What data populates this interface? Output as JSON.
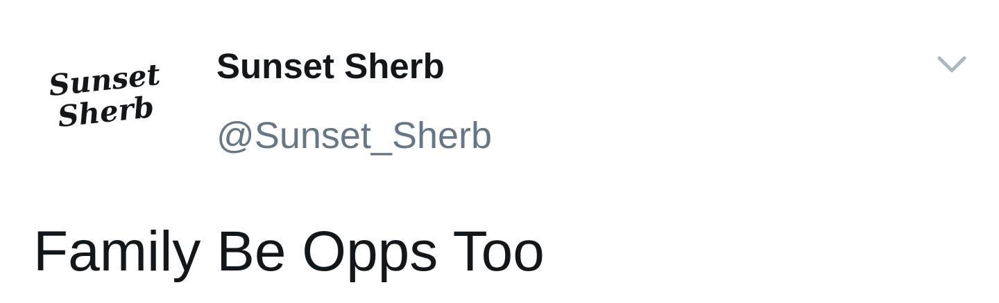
{
  "tweet": {
    "avatar": {
      "logo_line1": "Sunset",
      "logo_line2": "Sherb",
      "icon": "brand-logo"
    },
    "author": {
      "display_name": "Sunset Sherb",
      "handle": "@Sunset_Sherb"
    },
    "menu": {
      "icon": "chevron-down-icon"
    },
    "text": "Family Be Opps Too"
  },
  "colors": {
    "primary_text": "#14171a",
    "secondary_text": "#657786",
    "chevron": "#aab8c2",
    "background": "#ffffff"
  }
}
